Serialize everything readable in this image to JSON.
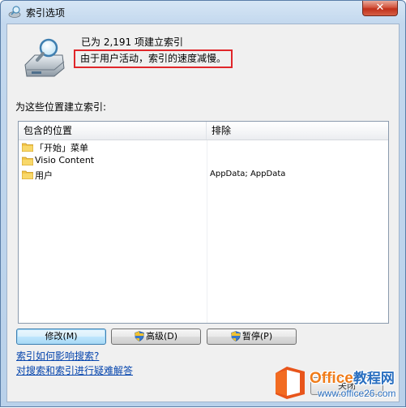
{
  "window": {
    "title": "索引选项",
    "close_glyph": "✕"
  },
  "status": {
    "count_line": "已为 2,191 项建立索引",
    "message": "由于用户活动，索引的速度减慢。"
  },
  "locations": {
    "label": "为这些位置建立索引:",
    "columns": [
      "包含的位置",
      "排除"
    ],
    "rows": [
      {
        "location": "「开始」菜单",
        "exclude": ""
      },
      {
        "location": "Visio Content",
        "exclude": ""
      },
      {
        "location": "用户",
        "exclude": "AppData; AppData"
      }
    ]
  },
  "buttons": {
    "modify": "修改(M)",
    "advanced": "高级(D)",
    "pause": "暂停(P)",
    "close": "关闭"
  },
  "links": {
    "how_affects_search": "索引如何影响搜索?",
    "troubleshoot": "对搜索和索引进行疑难解答"
  },
  "watermark": {
    "brand_latin": "Office",
    "brand_cn": "教程网",
    "url": "www.office26.com"
  },
  "colors": {
    "highlight_border": "#e0262a",
    "link": "#0645ad",
    "close_button": "#c0301a",
    "brand_orange": "#f07c1a",
    "brand_blue": "#2a6fc0"
  }
}
